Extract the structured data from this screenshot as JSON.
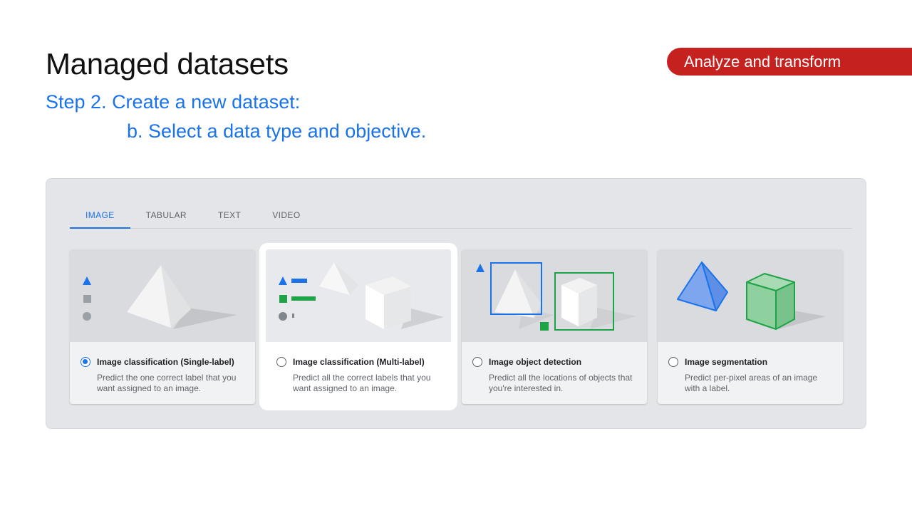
{
  "slide": {
    "title": "Managed datasets",
    "step": "Step 2. Create a new dataset:",
    "substep": "b. Select a data type and objective.",
    "section_tag": "Analyze and transform"
  },
  "colors": {
    "accent_blue": "#1a73e8",
    "tag_red": "#c5221f",
    "green": "#1ea446"
  },
  "tabs": [
    {
      "label": "IMAGE",
      "active": true
    },
    {
      "label": "TABULAR",
      "active": false
    },
    {
      "label": "TEXT",
      "active": false
    },
    {
      "label": "VIDEO",
      "active": false
    }
  ],
  "cards": [
    {
      "title": "Image classification (Single-label)",
      "desc": "Predict the one correct label that you want assigned to an image.",
      "selected": true,
      "illustration": "single-label-icon"
    },
    {
      "title": "Image classification (Multi-label)",
      "desc": "Predict all the correct labels that you want assigned to an image.",
      "selected": false,
      "illustration": "multi-label-icon"
    },
    {
      "title": "Image object detection",
      "desc": "Predict all the locations of objects that you're interested in.",
      "selected": false,
      "illustration": "object-detection-icon"
    },
    {
      "title": "Image segmentation",
      "desc": "Predict per-pixel areas of an image with a label.",
      "selected": false,
      "illustration": "segmentation-icon"
    }
  ]
}
